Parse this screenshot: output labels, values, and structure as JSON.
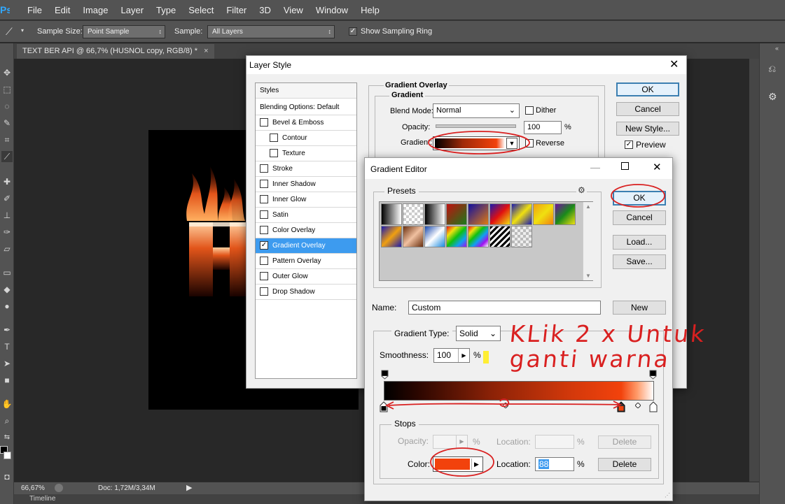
{
  "app": {
    "logo": "Ps",
    "menu": [
      "File",
      "Edit",
      "Image",
      "Layer",
      "Type",
      "Select",
      "Filter",
      "3D",
      "View",
      "Window",
      "Help"
    ]
  },
  "options_bar": {
    "tool_icon": "eyedropper-icon",
    "sample_size_label": "Sample Size:",
    "sample_size_value": "Point Sample",
    "sample_label": "Sample:",
    "sample_value": "All Layers",
    "show_ring_label": "Show Sampling Ring",
    "show_ring_checked": true
  },
  "document": {
    "tab_title": "TEXT BER API @ 66,7% (HUSNOL copy, RGB/8) *",
    "tab_close": "×",
    "artwork_letter": "H"
  },
  "status": {
    "zoom": "66,67%",
    "doc_info": "Doc: 1,72M/3,34M",
    "timeline_label": "Timeline"
  },
  "layer_style": {
    "title": "Layer Style",
    "close": "✕",
    "styles_header": "Styles",
    "blending_options": "Blending Options: Default",
    "items": [
      {
        "label": "Bevel & Emboss",
        "checked": false,
        "indent": false
      },
      {
        "label": "Contour",
        "checked": false,
        "indent": true
      },
      {
        "label": "Texture",
        "checked": false,
        "indent": true
      },
      {
        "label": "Stroke",
        "checked": false,
        "indent": false
      },
      {
        "label": "Inner Shadow",
        "checked": false,
        "indent": false
      },
      {
        "label": "Inner Glow",
        "checked": false,
        "indent": false
      },
      {
        "label": "Satin",
        "checked": false,
        "indent": false
      },
      {
        "label": "Color Overlay",
        "checked": false,
        "indent": false
      },
      {
        "label": "Gradient Overlay",
        "checked": true,
        "indent": false,
        "active": true
      },
      {
        "label": "Pattern Overlay",
        "checked": false,
        "indent": false
      },
      {
        "label": "Outer Glow",
        "checked": false,
        "indent": false
      },
      {
        "label": "Drop Shadow",
        "checked": false,
        "indent": false
      }
    ],
    "section_title": "Gradient Overlay",
    "sub_title": "Gradient",
    "blend_mode_label": "Blend Mode:",
    "blend_mode_value": "Normal",
    "dither_label": "Dither",
    "opacity_label": "Opacity:",
    "opacity_value": "100",
    "opacity_unit": "%",
    "gradient_label": "Gradient:",
    "reverse_label": "Reverse",
    "ok": "OK",
    "cancel": "Cancel",
    "new_style": "New Style...",
    "preview_label": "Preview",
    "preview_checked": true
  },
  "gradient_editor": {
    "title": "Gradient Editor",
    "presets_label": "Presets",
    "gear_icon": "gear-icon",
    "ok": "OK",
    "cancel": "Cancel",
    "load": "Load...",
    "save": "Save...",
    "name_label": "Name:",
    "name_value": "Custom",
    "new_button": "New",
    "gradient_type_label": "Gradient Type:",
    "gradient_type_value": "Solid",
    "smoothness_label": "Smoothness:",
    "smoothness_value": "100",
    "smoothness_unit": "%",
    "stops_label": "Stops",
    "opacity_label": "Opacity:",
    "opacity_unit": "%",
    "location_label": "Location:",
    "location_unit": "%",
    "delete_disabled": "Delete",
    "color_label": "Color:",
    "color_value": "#f2420c",
    "color_location": "88",
    "delete": "Delete",
    "color_stop_location": 88
  },
  "annotation": {
    "line1": "KLik 2 x Untuk",
    "line2": "ganti warna"
  },
  "colors": {
    "accent_blue": "#3d9bef",
    "ink_red": "#d92020",
    "gradient_start": "#000000",
    "gradient_mid": "#c2350c",
    "gradient_stop": "#f2420c",
    "gradient_end": "#ffffff"
  }
}
